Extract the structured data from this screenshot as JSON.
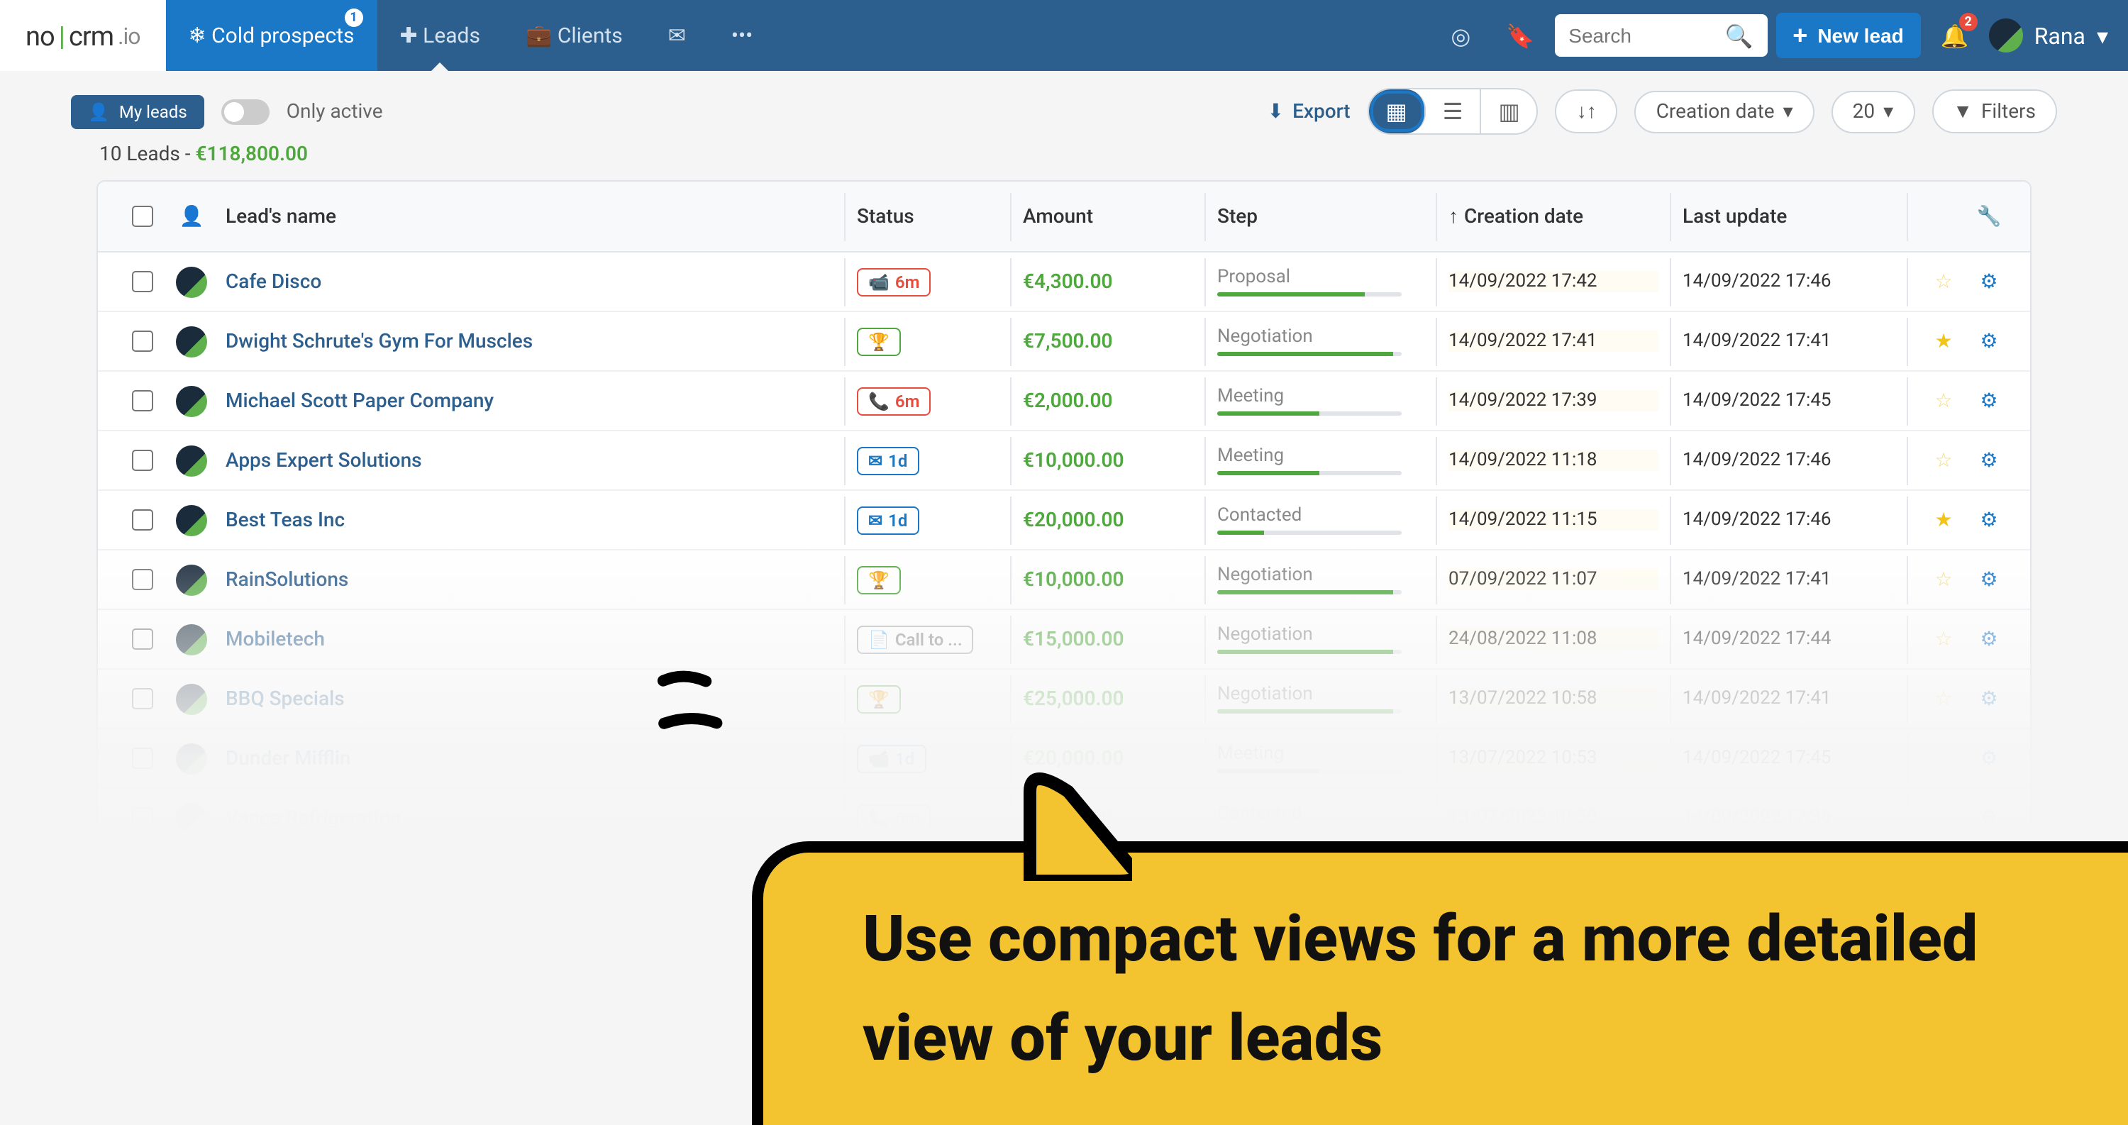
{
  "brand": {
    "no": "no",
    "bar": "|",
    "crm": "crm",
    "io": ".io"
  },
  "nav": {
    "cold": {
      "label": "Cold prospects",
      "badge": "1"
    },
    "leads": {
      "label": "Leads"
    },
    "clients": {
      "label": "Clients"
    }
  },
  "search": {
    "placeholder": "Search"
  },
  "newlead": {
    "label": "New lead"
  },
  "notif_count": "2",
  "user": {
    "name": "Rana"
  },
  "toolbar": {
    "myleads": "My leads",
    "onlyactive": "Only active",
    "export": "Export",
    "creationdate": "Creation date",
    "pagesize": "20",
    "filters": "Filters"
  },
  "summary": {
    "count": "10 Leads - ",
    "total": "€118,800.00"
  },
  "columns": {
    "name": "Lead's name",
    "status": "Status",
    "amount": "Amount",
    "step": "Step",
    "cdate": "Creation date",
    "udate": "Last update"
  },
  "rows": [
    {
      "name": "Cafe Disco",
      "status": {
        "type": "red",
        "icon": "video",
        "text": "6m"
      },
      "amount": "€4,300.00",
      "step": "Proposal",
      "progress": 80,
      "cdate": "14/09/2022 17:42",
      "udate": "14/09/2022 17:46",
      "starred": false
    },
    {
      "name": "Dwight Schrute's Gym For Muscles",
      "status": {
        "type": "green",
        "icon": "trophy",
        "text": ""
      },
      "amount": "€7,500.00",
      "step": "Negotiation",
      "progress": 95,
      "cdate": "14/09/2022 17:41",
      "udate": "14/09/2022 17:41",
      "starred": true
    },
    {
      "name": "Michael Scott Paper Company",
      "status": {
        "type": "red",
        "icon": "phone",
        "text": "6m"
      },
      "amount": "€2,000.00",
      "step": "Meeting",
      "progress": 55,
      "cdate": "14/09/2022 17:39",
      "udate": "14/09/2022 17:45",
      "starred": false
    },
    {
      "name": "Apps Expert Solutions",
      "status": {
        "type": "blue",
        "icon": "mail",
        "text": "1d"
      },
      "amount": "€10,000.00",
      "step": "Meeting",
      "progress": 55,
      "cdate": "14/09/2022 11:18",
      "udate": "14/09/2022 17:46",
      "starred": false
    },
    {
      "name": "Best Teas Inc",
      "status": {
        "type": "blue",
        "icon": "mail",
        "text": "1d"
      },
      "amount": "€20,000.00",
      "step": "Contacted",
      "progress": 25,
      "cdate": "14/09/2022 11:15",
      "udate": "14/09/2022 17:46",
      "starred": true
    },
    {
      "name": "RainSolutions",
      "status": {
        "type": "green",
        "icon": "trophy",
        "text": ""
      },
      "amount": "€10,000.00",
      "step": "Negotiation",
      "progress": 95,
      "cdate": "07/09/2022 11:07",
      "udate": "14/09/2022 17:41",
      "starred": false
    },
    {
      "name": "Mobiletech",
      "status": {
        "type": "grey",
        "icon": "doc",
        "text": "Call to ..."
      },
      "amount": "€15,000.00",
      "step": "Negotiation",
      "progress": 95,
      "cdate": "24/08/2022 11:08",
      "udate": "14/09/2022 17:44",
      "starred": false
    },
    {
      "name": "BBQ Specials",
      "status": {
        "type": "green",
        "icon": "trophy",
        "text": ""
      },
      "amount": "€25,000.00",
      "step": "Negotiation",
      "progress": 95,
      "cdate": "13/07/2022 10:58",
      "udate": "14/09/2022 17:41",
      "starred": false
    },
    {
      "name": "Dunder Mifflin",
      "status": {
        "type": "blue",
        "icon": "video",
        "text": "1d"
      },
      "amount": "€20,000.00",
      "step": "Meeting",
      "progress": 55,
      "cdate": "13/07/2022 10:53",
      "udate": "14/09/2022 17:45",
      "starred": false
    },
    {
      "name": "Vance Refrigeration",
      "status": {
        "type": "red",
        "icon": "phone",
        "text": "6m"
      },
      "amount": "€5,000.00",
      "step": "Contacted",
      "progress": 25,
      "cdate": "13/07/2022 10:50",
      "udate": "14/09/2022 17:36",
      "starred": false
    }
  ],
  "callout": "Use compact views for a more detailed view of your leads"
}
